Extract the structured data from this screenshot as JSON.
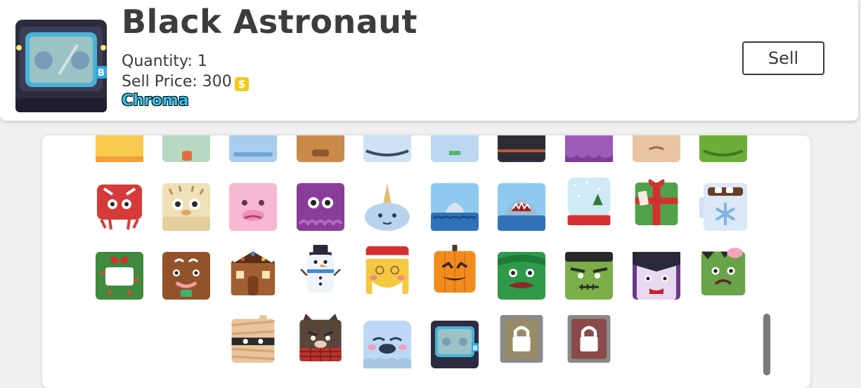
{
  "item": {
    "name": "Black Astronaut",
    "quantity_label": "Quantity: 1",
    "sell_price_label": "Sell Price: 300",
    "coin_symbol": "$",
    "rarity": "Chroma",
    "rarity_color": "#2fc4f0",
    "icon": "black-astronaut"
  },
  "actions": {
    "sell_label": "Sell"
  },
  "grid": {
    "rows": [
      [
        "partial-yellow",
        "partial-mint",
        "partial-blue",
        "partial-brown",
        "partial-globe",
        "partial-lightblue",
        "partial-dark",
        "partial-purple",
        "partial-tan",
        "partial-green"
      ],
      [
        "crab",
        "pufferfish",
        "blobfish",
        "octopus",
        "narwhal",
        "baby-shark",
        "mega-shark",
        "snow-globe",
        "present",
        "hot-cocoa"
      ],
      [
        "wreath",
        "gingerbread-man",
        "gingerbread-house",
        "snowman",
        "santa-claus",
        "jack-o-lantern",
        "swamp-monster",
        "frankenstein",
        "vampire",
        "zombie"
      ],
      [
        "mummy",
        "werewolf",
        "ghost",
        "black-astronaut",
        "locked",
        "locked"
      ]
    ]
  },
  "colors": {
    "accent": "#2fc4f0",
    "coin": "#f5c814",
    "locked": "#8a8a8a"
  }
}
